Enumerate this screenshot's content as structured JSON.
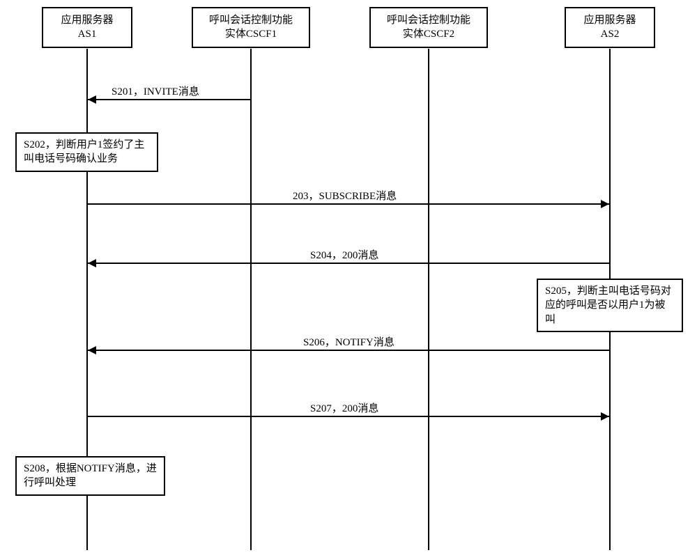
{
  "participants": {
    "as1": {
      "line1": "应用服务器",
      "line2": "AS1"
    },
    "cscf1": {
      "line1": "呼叫会话控制功能",
      "line2": "实体CSCF1"
    },
    "cscf2": {
      "line1": "呼叫会话控制功能",
      "line2": "实体CSCF2"
    },
    "as2": {
      "line1": "应用服务器",
      "line2": "AS2"
    }
  },
  "messages": {
    "s201": "S201，INVITE消息",
    "s203": "203，SUBSCRIBE消息",
    "s204": "S204，200消息",
    "s206": "S206，NOTIFY消息",
    "s207": "S207，200消息"
  },
  "processes": {
    "s202": "S202，判断用户1签约了主叫电话号码确认业务",
    "s205": "S205，判断主叫电话号码对应的呼叫是否以用户1为被叫",
    "s208": "S208，根据NOTIFY消息，进行呼叫处理"
  }
}
